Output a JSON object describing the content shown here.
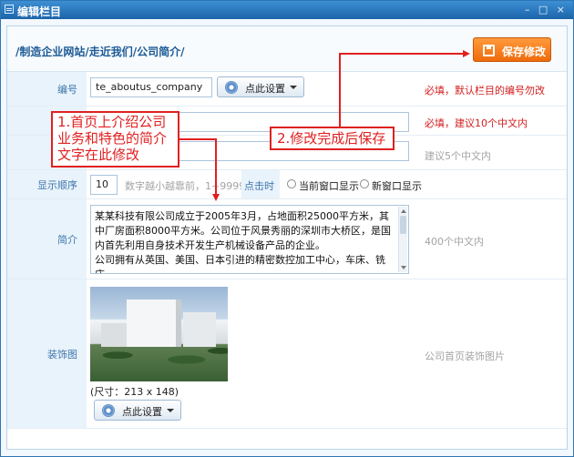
{
  "window": {
    "title": "编辑栏目",
    "controls": "– □ ×"
  },
  "breadcrumb": "/制造企业网站/走近我们/公司简介/",
  "save_button": {
    "label": "保存修改"
  },
  "form": {
    "code": {
      "label": "编号",
      "value": "te_aboutus_company",
      "button": "点此设置",
      "hint": "必填，默认栏目的编号勿改"
    },
    "name": {
      "hint": "必填，建议10个中文内"
    },
    "short_name": {
      "hint": "建议5个中文内"
    },
    "order": {
      "label": "显示顺序",
      "value": "10",
      "hint": "数字越小越靠前，1~9999",
      "click_label": "点击时",
      "options": [
        "当前窗口显示",
        "新窗口显示"
      ]
    },
    "intro": {
      "label": "简介",
      "text": "某某科技有限公司成立于2005年3月，占地面积25000平方米，其中厂房面积8000平方米。公司位于风景秀丽的深圳市大桥区，是国内首先利用自身技术开发生产机械设备产品的企业。\n公司拥有从英国、美国、日本引进的精密数控加工中心，车床、铣床、",
      "hint": "400个中文内"
    },
    "decor": {
      "label": "装饰图",
      "size_text": "(尺寸：213 x 148)",
      "button": "点此设置",
      "hint": "公司首页装饰图片"
    }
  },
  "annotations": {
    "a1": "1.首页上介绍公司业务和特色的简介文字在此修改",
    "a2": "2.修改完成后保存"
  },
  "colors": {
    "accent": "#ef6b0b",
    "annotation": "#e02020",
    "titlebar": "#1c64aa"
  }
}
